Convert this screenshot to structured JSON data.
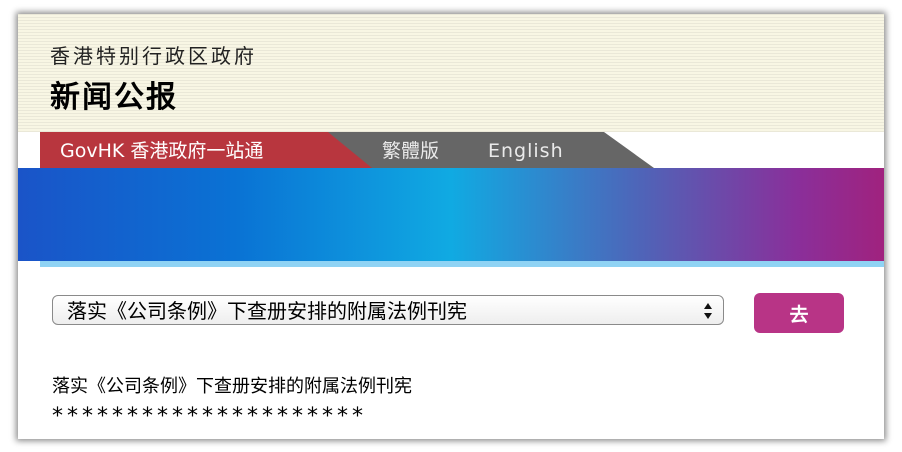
{
  "header": {
    "gov_name": "香港特别行政区政府",
    "page_title": "新闻公报"
  },
  "tabs": {
    "govhk_label": "GovHK 香港政府一站通",
    "traditional_label": "繁體版",
    "english_label": "English"
  },
  "article_select": {
    "selected": "落实《公司条例》下查册安排的附属法例刊宪"
  },
  "go_button": {
    "label": "去"
  },
  "article": {
    "title": "落实《公司条例》下查册安排的附属法例刊宪",
    "separator": "*********************"
  },
  "colors": {
    "header_bg": "#f8f6e4",
    "govhk_tab": "#b8363e",
    "lang_tab": "#666666",
    "go_button": "#b83486",
    "banner_blue": "#1a54c8",
    "banner_purple": "#a0227e"
  },
  "icons": {
    "select_arrows": "updown-arrows-icon"
  }
}
